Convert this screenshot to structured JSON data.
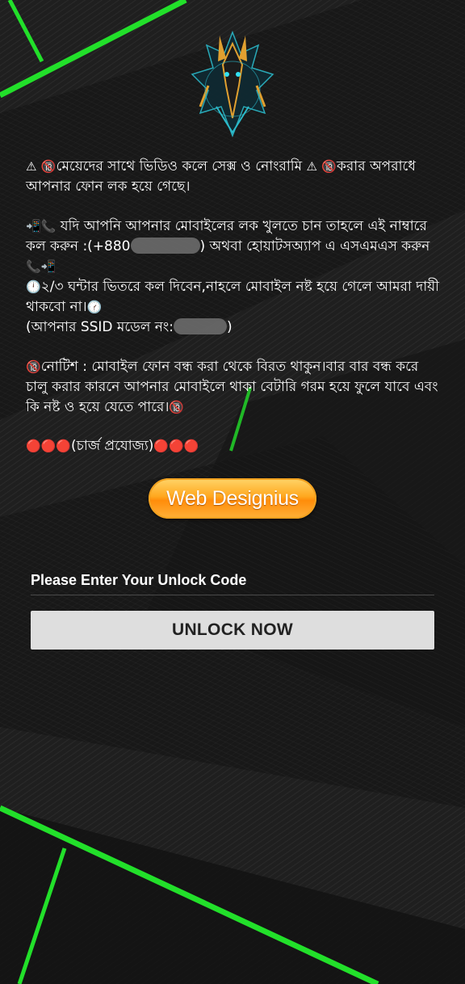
{
  "message": {
    "para1": {
      "warn_icon_1": "⚠",
      "noentry_icon_1": "🔞",
      "text_1": "মেয়েদের সাথে ভিডিও কলে সেক্স ও নোংরামি ",
      "warn_icon_2": "⚠",
      "noentry_icon_2": "🔞",
      "text_2": "করার অপরাধে আপনার ফোন লক হয়ে গেছে।"
    },
    "para2": {
      "phone_icons_1": "📲📞",
      "text_1": " যদি আপনি আপনার মোবাইলের লক খুলতে চান তাহলে এই নাম্বারে কল করুন :(+880",
      "text_2": ") অথবা হোয়াটসঅ্যাপ এ এসএমএস করুন ",
      "phone_icons_2": "📞📲",
      "clock_icon": "🕛",
      "text_3": "২/৩ ঘন্টার ভিতরে কল দিবেন,নাহলে মোবাইল নষ্ট হয়ে গেলে আমরা দায়ী থাকবো না।",
      "clock_icon_2": "🕜",
      "text_4": "(আপনার SSID মডেল নং:",
      "text_5": ")"
    },
    "para3": {
      "noentry_icon_1": "🔞",
      "text": "নোটিশ : মোবাইল ফোন বন্ধ করা থেকে বিরত থাকুন।বার বার বন্ধ করে চালু করার কারনে আপনার মোবাইলে থাকা বেটারি গরম হয়ে ফুলে যাবে এবং কি নষ্ট ও হয়ে যেতে পারে।",
      "noentry_icon_2": "🔞"
    },
    "para4": {
      "dots_left": "🔴🔴🔴",
      "text": "(চার্জ প্রযোজ্য)",
      "dots_right": "🔴🔴🔴"
    }
  },
  "brand_button": {
    "label": "Web Designius"
  },
  "unlock": {
    "label": "Please Enter Your Unlock Code",
    "input_value": "",
    "button_label": "UNLOCK NOW"
  },
  "colors": {
    "neon_green": "#22e02a",
    "background": "#1b1b1b",
    "button_gray": "#dedede",
    "brand_orange": "#ff9a10"
  },
  "logo": {
    "icon": "anubis-jackal-emblem"
  }
}
